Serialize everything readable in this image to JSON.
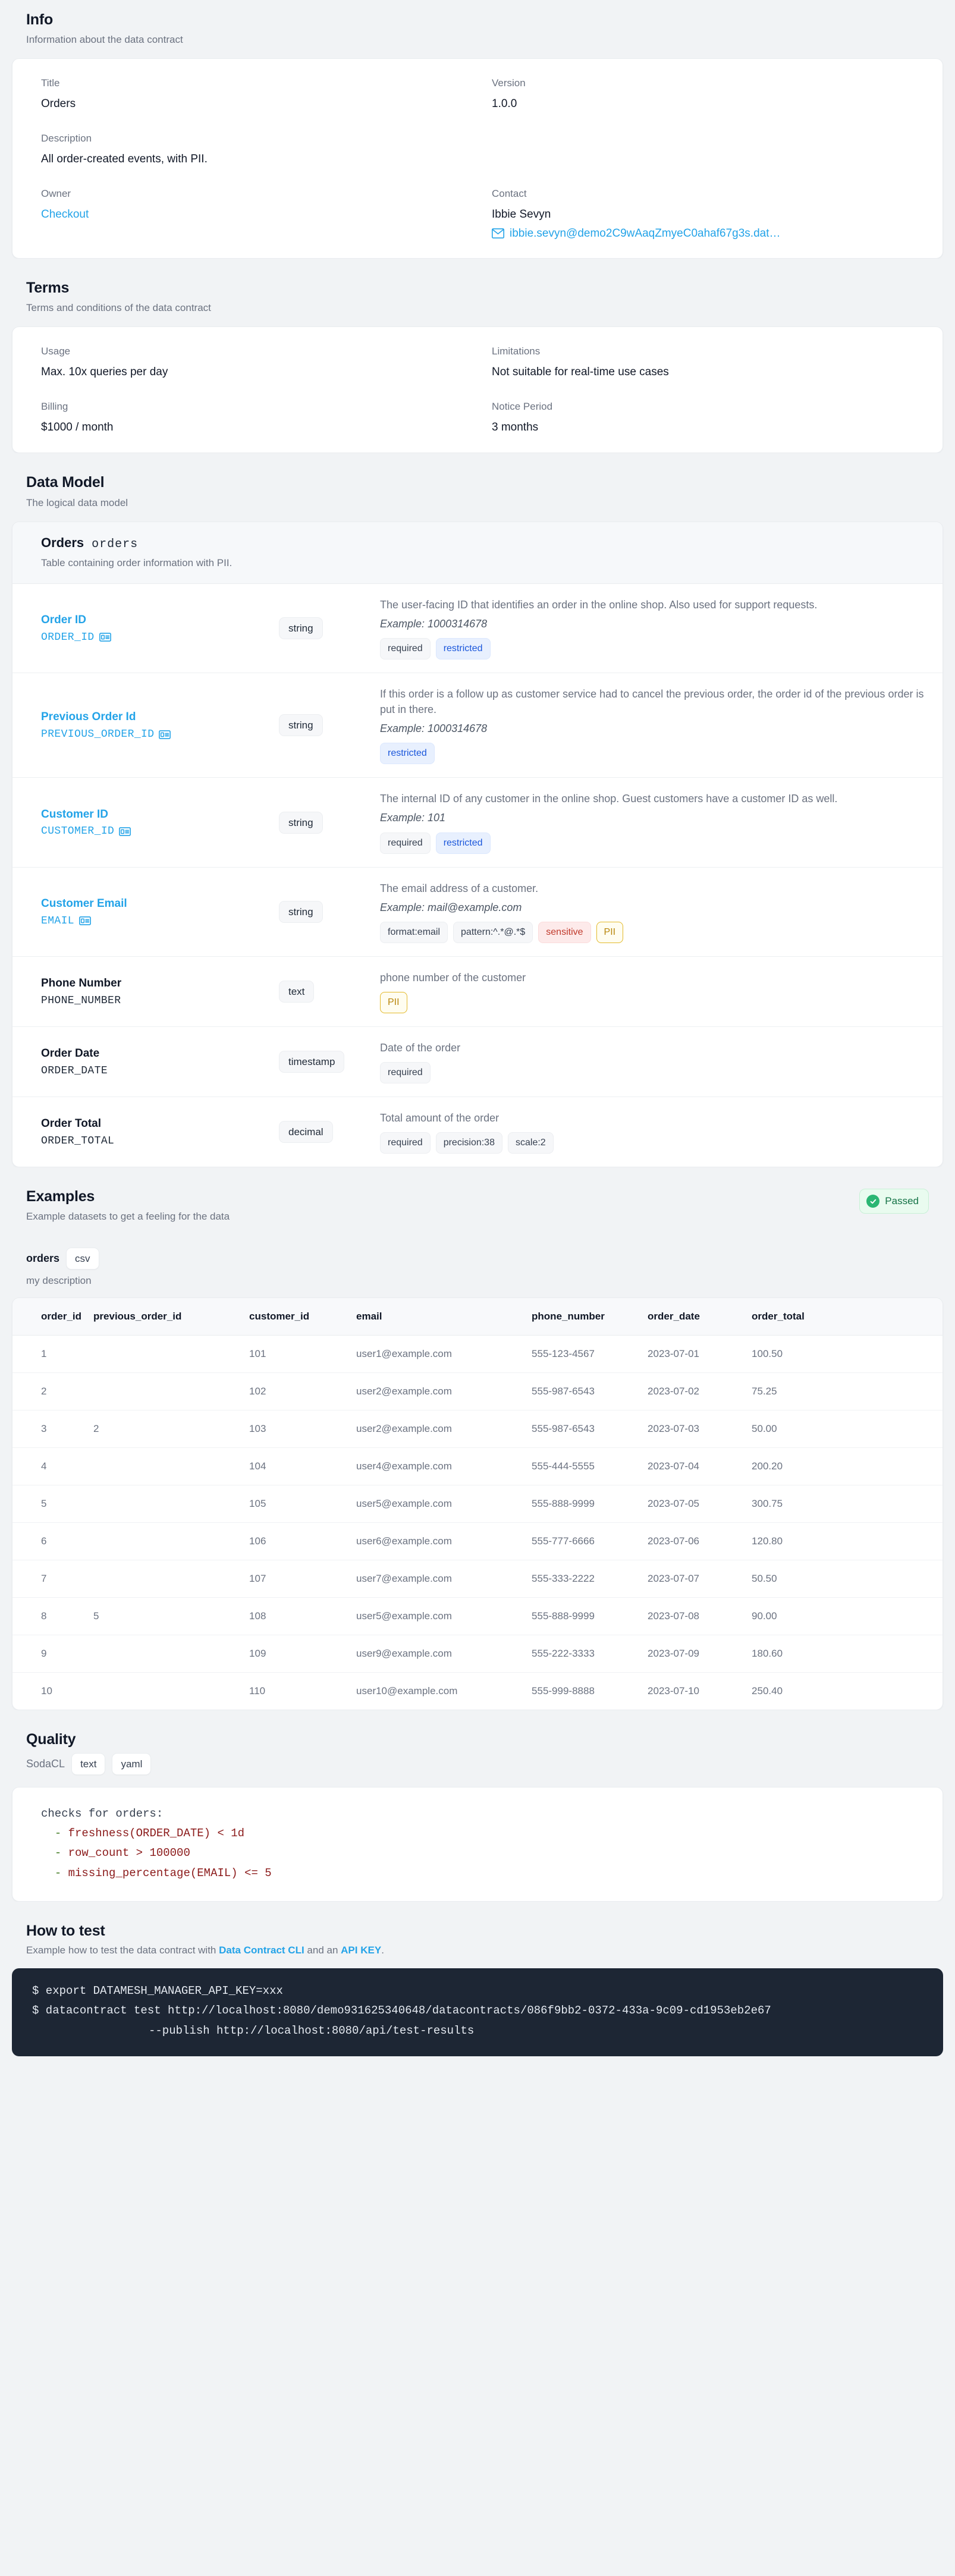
{
  "info": {
    "title": "Info",
    "subtitle": "Information about the data contract",
    "fields": [
      {
        "label": "Title",
        "value": "Orders"
      },
      {
        "label": "Version",
        "value": "1.0.0"
      },
      {
        "label": "Description",
        "value": "All order-created events, with PII."
      },
      {
        "label": "Owner",
        "value": "Checkout"
      },
      {
        "label": "Contact",
        "value": "Ibbie Sevyn"
      }
    ],
    "contact_email": "ibbie.sevyn@demo2C9wAaqZmyeC0ahaf67g3s.dat…"
  },
  "terms": {
    "title": "Terms",
    "subtitle": "Terms and conditions of the data contract",
    "usage_label": "Usage",
    "usage_value": "Max. 10x queries per day",
    "limitations_label": "Limitations",
    "limitations_value": "Not suitable for real-time use cases",
    "billing_label": "Billing",
    "billing_value": "$1000 / month",
    "notice_label": "Notice Period",
    "notice_value": "3 months"
  },
  "data_model": {
    "title": "Data Model",
    "subtitle": "The logical data model",
    "model_title": "Orders",
    "model_physical": "orders",
    "model_desc": "Table containing order information with PII.",
    "fields": [
      {
        "name": "Order ID",
        "physical": "ORDER_ID",
        "is_link": true,
        "has_id_icon": true,
        "type": "string",
        "description": "The user-facing ID that identifies an order in the online shop. Also used for support requests.",
        "example": "Example: 1000314678",
        "badges": [
          {
            "text": "required",
            "style": "plain"
          },
          {
            "text": "restricted",
            "style": "blue"
          }
        ]
      },
      {
        "name": "Previous Order Id",
        "physical": "PREVIOUS_ORDER_ID",
        "is_link": true,
        "has_id_icon": true,
        "type": "string",
        "description": "If this order is a follow up as customer service had to cancel the previous order, the order id of the previous order is put in there.",
        "example": "Example: 1000314678",
        "badges": [
          {
            "text": "restricted",
            "style": "blue"
          }
        ]
      },
      {
        "name": "Customer ID",
        "physical": "CUSTOMER_ID",
        "is_link": true,
        "has_id_icon": true,
        "type": "string",
        "description": "The internal ID of any customer in the online shop. Guest customers have a customer ID as well.",
        "example": "Example: 101",
        "badges": [
          {
            "text": "required",
            "style": "plain"
          },
          {
            "text": "restricted",
            "style": "blue"
          }
        ]
      },
      {
        "name": "Customer Email",
        "physical": "EMAIL",
        "is_link": true,
        "has_id_icon": true,
        "type": "string",
        "description": "The email address of a customer.",
        "example": "Example: mail@example.com",
        "badges": [
          {
            "text": "format:email",
            "style": "plain"
          },
          {
            "text": "pattern:^.*@.*$",
            "style": "plain"
          },
          {
            "text": "sensitive",
            "style": "red"
          },
          {
            "text": "PII",
            "style": "gold"
          }
        ]
      },
      {
        "name": "Phone Number",
        "physical": "PHONE_NUMBER",
        "is_link": false,
        "has_id_icon": false,
        "type": "text",
        "description": "phone number of the customer",
        "example": "",
        "badges": [
          {
            "text": "PII",
            "style": "gold"
          }
        ]
      },
      {
        "name": "Order Date",
        "physical": "ORDER_DATE",
        "is_link": false,
        "has_id_icon": false,
        "type": "timestamp",
        "description": "Date of the order",
        "example": "",
        "badges": [
          {
            "text": "required",
            "style": "plain"
          }
        ]
      },
      {
        "name": "Order Total",
        "physical": "ORDER_TOTAL",
        "is_link": false,
        "has_id_icon": false,
        "type": "decimal",
        "description": "Total amount of the order",
        "example": "",
        "badges": [
          {
            "text": "required",
            "style": "plain"
          },
          {
            "text": "precision:38",
            "style": "plain"
          },
          {
            "text": "scale:2",
            "style": "plain"
          }
        ]
      }
    ]
  },
  "examples": {
    "title": "Examples",
    "subtitle": "Example datasets to get a feeling for the data",
    "status_badge": "Passed",
    "dataset_name": "orders",
    "dataset_format": "csv",
    "dataset_description": "my description",
    "columns": [
      "order_id",
      "previous_order_id",
      "customer_id",
      "email",
      "phone_number",
      "order_date",
      "order_total"
    ],
    "rows": [
      [
        "1",
        "",
        "101",
        "user1@example.com",
        "555-123-4567",
        "2023-07-01",
        "100.50"
      ],
      [
        "2",
        "",
        "102",
        "user2@example.com",
        "555-987-6543",
        "2023-07-02",
        "75.25"
      ],
      [
        "3",
        "2",
        "103",
        "user2@example.com",
        "555-987-6543",
        "2023-07-03",
        "50.00"
      ],
      [
        "4",
        "",
        "104",
        "user4@example.com",
        "555-444-5555",
        "2023-07-04",
        "200.20"
      ],
      [
        "5",
        "",
        "105",
        "user5@example.com",
        "555-888-9999",
        "2023-07-05",
        "300.75"
      ],
      [
        "6",
        "",
        "106",
        "user6@example.com",
        "555-777-6666",
        "2023-07-06",
        "120.80"
      ],
      [
        "7",
        "",
        "107",
        "user7@example.com",
        "555-333-2222",
        "2023-07-07",
        "50.50"
      ],
      [
        "8",
        "5",
        "108",
        "user5@example.com",
        "555-888-9999",
        "2023-07-08",
        "90.00"
      ],
      [
        "9",
        "",
        "109",
        "user9@example.com",
        "555-222-3333",
        "2023-07-09",
        "180.60"
      ],
      [
        "10",
        "",
        "110",
        "user10@example.com",
        "555-999-8888",
        "2023-07-10",
        "250.40"
      ]
    ]
  },
  "quality": {
    "title": "Quality",
    "kind": "SodaCL",
    "tab_text": "text",
    "tab_yaml": "yaml",
    "code_header": "checks for orders:",
    "code_lines": [
      "freshness(ORDER_DATE) < 1d",
      "row_count > 100000",
      "missing_percentage(EMAIL) <= 5"
    ]
  },
  "howto": {
    "title": "How to test",
    "sub_prefix": "Example how to test the data contract with ",
    "link_cli": "Data Contract CLI",
    "sub_mid": " and an ",
    "link_api": "API KEY",
    "sub_suffix": ".",
    "terminal_line1": "$ export DATAMESH_MANAGER_API_KEY=xxx",
    "terminal_line2": "$ datacontract test http://localhost:8080/demo931625340648/datacontracts/086f9bb2-0372-433a-9c09-cd1953eb2e67",
    "terminal_line3": "--publish http://localhost:8080/api/test-results"
  }
}
